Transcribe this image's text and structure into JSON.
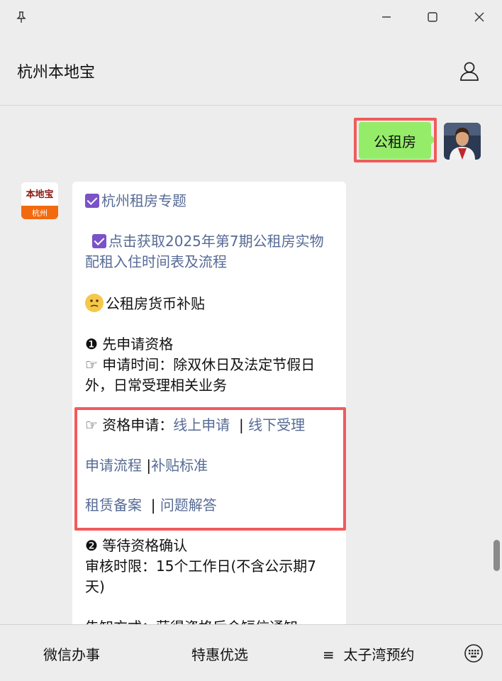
{
  "window": {
    "title": "杭州本地宝",
    "pin_icon": "pin-icon",
    "minimize_icon": "minimize-icon",
    "maximize_icon": "maximize-icon",
    "close_icon": "close-icon"
  },
  "header": {
    "title": "杭州本地宝",
    "user_icon": "person-icon"
  },
  "chat": {
    "outgoing": {
      "text": "公租房"
    },
    "account_logo": {
      "top": "本地宝",
      "bottom": "杭州"
    },
    "incoming": {
      "line1": "杭州租房专题",
      "line2a": "点击获取2025年第7期公租房实物",
      "line2b": "配租入住时间表及流程",
      "line3": "公租房货币补贴",
      "line4": "❶ 先申请资格",
      "line5a": "☞ 申请时间：除双休日及法定节假日",
      "line5b": "外，日常受理相关业务",
      "line6_prefix": "☞ 资格申请：",
      "link_online": "线上申请",
      "link_offline": "线下受理",
      "link_process": "申请流程",
      "link_standard": "补贴标准",
      "link_record": "租赁备案",
      "link_faq": "问题解答",
      "line8": "❷ 等待资格确认",
      "line9a": "审核时限：15个工作日(不含公示期7",
      "line9b": "天)",
      "line10": "告知方式：获得资格后会短信通知"
    }
  },
  "bottom_menu": {
    "item1": "微信办事",
    "item2": "特惠优选",
    "item3_icon": "≡",
    "item3": "太子湾预约",
    "keyboard_icon": "keyboard-icon"
  },
  "colors": {
    "bubble_out": "#95ec69",
    "link": "#576b95",
    "highlight": "#f15b5b"
  }
}
